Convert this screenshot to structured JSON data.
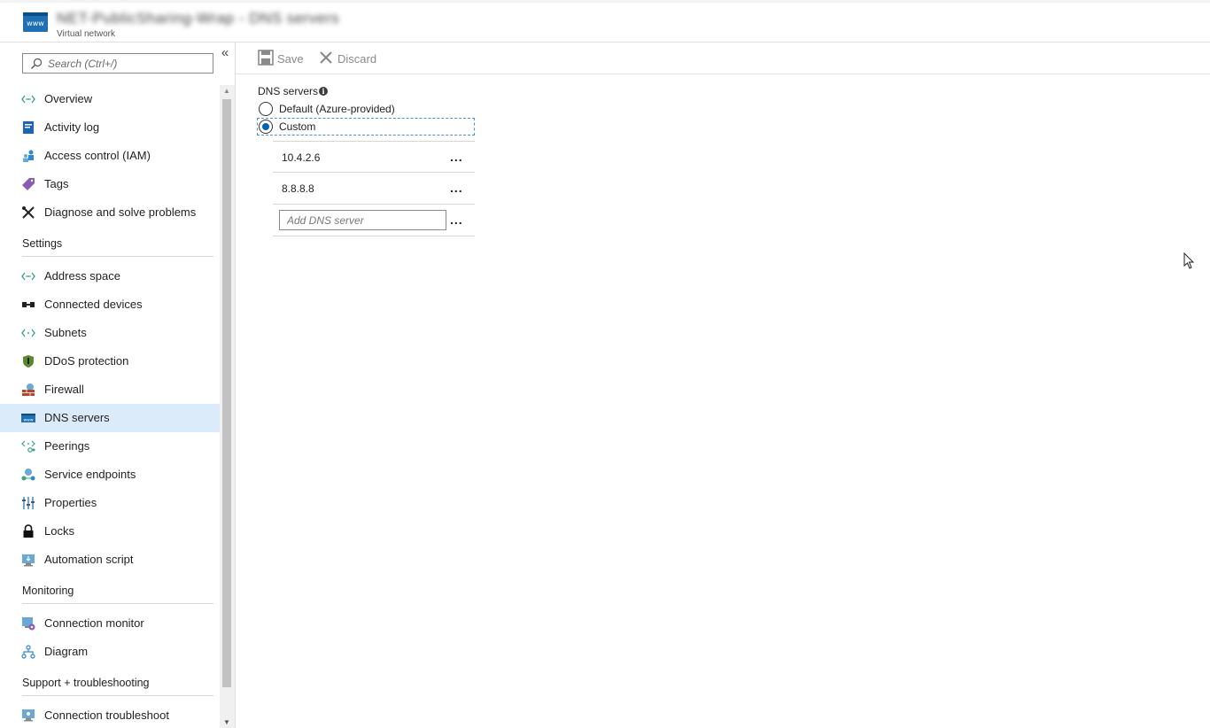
{
  "header": {
    "icon_text": "www",
    "title": "NET-PublicSharing-Wrap - DNS servers",
    "subtitle": "Virtual network"
  },
  "sidebar": {
    "search_placeholder": "Search (Ctrl+/)",
    "collapse_glyph": "«",
    "items": [
      {
        "label": "Overview",
        "icon": "overview-icon"
      },
      {
        "label": "Activity log",
        "icon": "activity-log-icon"
      },
      {
        "label": "Access control (IAM)",
        "icon": "iam-icon"
      },
      {
        "label": "Tags",
        "icon": "tag-icon"
      },
      {
        "label": "Diagnose and solve problems",
        "icon": "wrench-icon"
      }
    ],
    "settings_header": "Settings",
    "settings_items": [
      {
        "label": "Address space",
        "icon": "address-space-icon"
      },
      {
        "label": "Connected devices",
        "icon": "connected-devices-icon"
      },
      {
        "label": "Subnets",
        "icon": "subnets-icon"
      },
      {
        "label": "DDoS protection",
        "icon": "shield-icon"
      },
      {
        "label": "Firewall",
        "icon": "firewall-icon"
      },
      {
        "label": "DNS servers",
        "icon": "dns-icon",
        "active": true
      },
      {
        "label": "Peerings",
        "icon": "peerings-icon"
      },
      {
        "label": "Service endpoints",
        "icon": "service-endpoints-icon"
      },
      {
        "label": "Properties",
        "icon": "properties-icon"
      },
      {
        "label": "Locks",
        "icon": "lock-icon"
      },
      {
        "label": "Automation script",
        "icon": "automation-script-icon"
      }
    ],
    "monitoring_header": "Monitoring",
    "monitoring_items": [
      {
        "label": "Connection monitor",
        "icon": "connection-monitor-icon"
      },
      {
        "label": "Diagram",
        "icon": "diagram-icon"
      }
    ],
    "support_header": "Support + troubleshooting",
    "support_items": [
      {
        "label": "Connection troubleshoot",
        "icon": "connection-troubleshoot-icon"
      }
    ]
  },
  "toolbar": {
    "save_label": "Save",
    "discard_label": "Discard"
  },
  "content": {
    "dns_servers_label": "DNS servers",
    "option_default": "Default (Azure-provided)",
    "option_custom": "Custom",
    "selected_option": "Custom",
    "servers": [
      "10.4.2.6",
      "8.8.8.8"
    ],
    "add_placeholder": "Add DNS server",
    "more_glyph": "..."
  },
  "colors": {
    "active_item_bg": "#dcebfa",
    "accent": "#0063b1",
    "azure_blue": "#1f6fb5"
  }
}
